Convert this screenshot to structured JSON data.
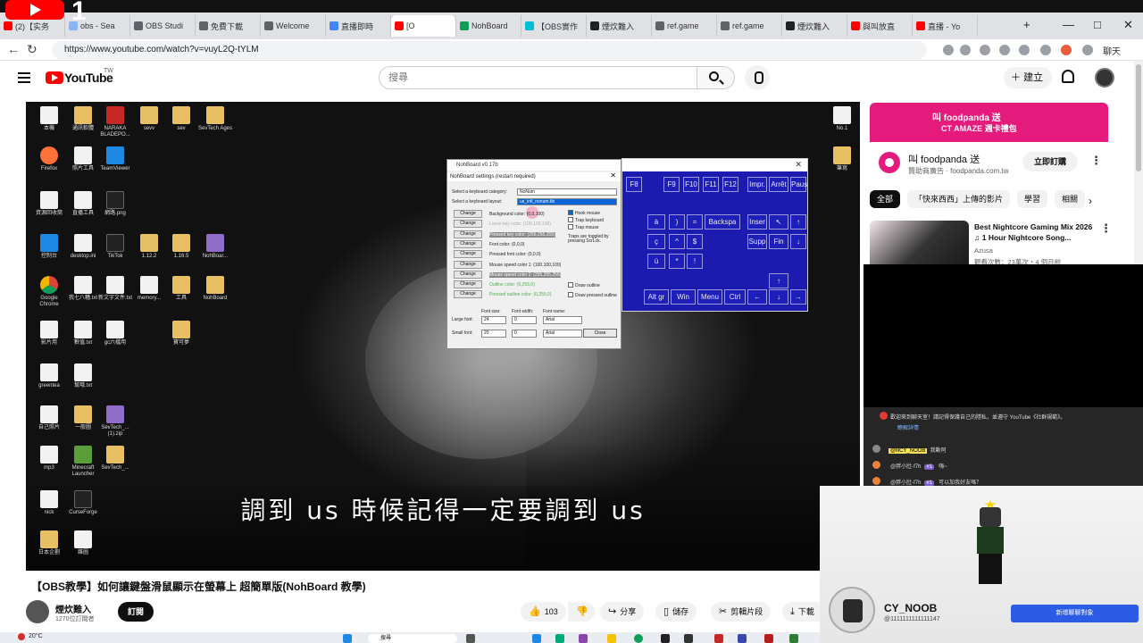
{
  "browser": {
    "tabs": [
      {
        "label": "(2)【实务",
        "color": "#ff0000"
      },
      {
        "label": "obs - Sea",
        "color": "#8ab4f8"
      },
      {
        "label": "OBS Studi",
        "color": "#5f6368"
      },
      {
        "label": "免費下載",
        "color": "#5f6368"
      },
      {
        "label": "Welcome",
        "color": "#5f6368"
      },
      {
        "label": "直播即時",
        "color": "#4285f4"
      },
      {
        "label": "[O",
        "color": "#ff0000"
      },
      {
        "label": "NohBoard",
        "color": "#0f9d58"
      },
      {
        "label": "【OBS實作",
        "color": "#00bcd4"
      },
      {
        "label": "煙炊難入",
        "color": "#202124"
      },
      {
        "label": "ref.game",
        "color": "#5f6368"
      },
      {
        "label": "ref.game",
        "color": "#5f6368"
      },
      {
        "label": "煙炊難入",
        "color": "#202124"
      },
      {
        "label": "與叫放直",
        "color": "#ff0000"
      },
      {
        "label": "直播 - Yo",
        "color": "#ff0000"
      }
    ],
    "big_count": "1",
    "url": "https://www.youtube.com/watch?v=vuyL2Q-tYLM",
    "chat_label": "聊天"
  },
  "youtube": {
    "logo_text": "YouTube",
    "region": "TW",
    "search_placeholder": "搜尋",
    "create_label": "建立"
  },
  "player": {
    "subtitle": "調到 us 時候記得一定要調到 us",
    "desktop_icons": [
      {
        "label": "本機",
        "type": "file"
      },
      {
        "label": "通訊軟體",
        "type": "folder"
      },
      {
        "label": "NARAKA BLADEPO...",
        "type": "red"
      },
      {
        "label": "sevv",
        "type": "folder"
      },
      {
        "label": "sev",
        "type": "folder"
      },
      {
        "label": "SevTech Ages",
        "type": "folder"
      },
      {
        "label": "Firefox",
        "type": "fox"
      },
      {
        "label": "照片工具",
        "type": "file"
      },
      {
        "label": "TeamViewer",
        "type": "blue"
      },
      {
        "label": "資源回收筒",
        "type": "file"
      },
      {
        "label": "直播工具",
        "type": "file"
      },
      {
        "label": "網路.png",
        "type": "dark"
      },
      {
        "label": "控制台",
        "type": "blue"
      },
      {
        "label": "desktop.ini",
        "type": "file"
      },
      {
        "label": "TikTok",
        "type": "dark"
      },
      {
        "label": "1.12.2",
        "type": "folder"
      },
      {
        "label": "1.16.5",
        "type": "folder"
      },
      {
        "label": "NohBoar...",
        "type": "win"
      },
      {
        "label": "Google Chrome",
        "type": "chrome"
      },
      {
        "label": "我七八糟.txt",
        "type": "file"
      },
      {
        "label": "新文字文件.txt",
        "type": "file"
      },
      {
        "label": "memory...",
        "type": "file"
      },
      {
        "label": "工具",
        "type": "folder"
      },
      {
        "label": "NohBoard",
        "type": "folder"
      },
      {
        "label": "影片用",
        "type": "file"
      },
      {
        "label": "數值.txt",
        "type": "file"
      },
      {
        "label": "gc六檔用",
        "type": "file"
      },
      {
        "label": "寶可夢",
        "type": "folder"
      },
      {
        "label": "greentea",
        "type": "file"
      },
      {
        "label": "幫哦.txt",
        "type": "file"
      },
      {
        "label": "自己照片",
        "type": "file"
      },
      {
        "label": "一般圖",
        "type": "folder"
      },
      {
        "label": "SevTech_...(1).zip",
        "type": "win"
      },
      {
        "label": "mp3",
        "type": "file"
      },
      {
        "label": "Minecraft Launcher",
        "type": "green"
      },
      {
        "label": "SevTech_...",
        "type": "folder"
      },
      {
        "label": "nick",
        "type": "file"
      },
      {
        "label": "CurseForge",
        "type": "dark"
      },
      {
        "label": "日本企劃",
        "type": "folder"
      },
      {
        "label": "雜圖",
        "type": "file"
      },
      {
        "label": "No.1",
        "type": "file"
      },
      {
        "label": "筆寫",
        "type": "folder"
      }
    ],
    "nohboard": {
      "keyboard_title": "NohBoard v0.17b",
      "keys": [
        "F8",
        "F9",
        "F10",
        "F11",
        "F12",
        "Impr.",
        "Arrêt",
        "Paus",
        "à",
        ")",
        "=",
        "Backspa",
        "Inser",
        "↖",
        "↑",
        "ç",
        "^",
        "$",
        "Supp",
        "Fin",
        "↓",
        "ù",
        "*",
        "!",
        "Alt gr",
        "Win",
        "Menu",
        "Ctrl",
        "↑",
        "←",
        "↓",
        "→"
      ],
      "settings_title": "NohBoard settings (restart required)",
      "select_category_label": "Select a keyboard category:",
      "select_category_value": "NoNum",
      "select_layout_label": "Select a keyboard layout:",
      "select_layout_value": "us_intl_nonum.kb",
      "change_label": "Change",
      "color_rows": [
        "Background color: (0,0,100)",
        "Loose key color: (100,100,100)",
        "Pressed key color: (255,255,255)",
        "Font color: (0,0,0)",
        "Pressed font color: (0,0,0)",
        "Mouse speed color 1: (100,100,100)",
        "Mouse speed color 2: (255,255,255)",
        "Outline color: (0,255,0)",
        "Pressed outline color: (0,255,0)"
      ],
      "checks": [
        "Hook mouse",
        "Trap keyboard",
        "Trap mouse"
      ],
      "trap_note": "Traps are toggled by pressing ScrLck.",
      "outline_checks": [
        "Draw outline",
        "Draw pressed outline"
      ],
      "font_headers": [
        "Font size:",
        "Font width:",
        "Font name:"
      ],
      "large_font": {
        "label": "Large font:",
        "size": "24",
        "width": "0",
        "name": "Arial"
      },
      "small_font": {
        "label": "Small font:",
        "size": "20",
        "width": "0",
        "name": "Arial"
      },
      "close_label": "Close"
    }
  },
  "video": {
    "title": "【OBS教學】如何讓鍵盤滑鼠顯示在螢幕上 超簡單版(NohBoard 教學)",
    "channel": "煙炊難入",
    "subscribers": "1270位訂閱者",
    "subscribe_label": "訂閱",
    "likes": "103",
    "actions": [
      "分享",
      "儲存",
      "剪輯片段",
      "下載"
    ]
  },
  "sidebar": {
    "ad_banner_line1": "叫 foodpanda 送",
    "ad_banner_line2": "CT AMAZE 週卡禮包",
    "ad_title": "叫 foodpanda 送",
    "ad_sponsor": "贊助商廣告 · foodpanda.com.tw",
    "ad_cta": "立即訂購",
    "chips": [
      "全部",
      "「快來西西」上傳的影片",
      "學習",
      "相關"
    ],
    "recommendation": {
      "title": "Best Nightcore Gaming Mix 2026 ♫ 1 Hour Nightcore Song...",
      "channel": "Azusa",
      "meta": "觀看次數：23萬次・4 個月前"
    }
  },
  "chat": {
    "notice": "歡迎來到聊天室！請記得保護自己的隱私，並遵守 YouTube《社群規範》。",
    "notice_link": "瞭解詳情",
    "messages": [
      {
        "name": "@lllCY_NOOB",
        "badge": "",
        "text": "我動阿",
        "owner": true
      },
      {
        "name": "@胖小壯-f7h",
        "badge": "#1",
        "text": "嗨~",
        "owner": false
      },
      {
        "name": "@胖小壯-f7h",
        "badge": "#1",
        "text": "可以加我好友嗎？",
        "owner": false
      }
    ]
  },
  "streamer": {
    "name": "CY_NOOB",
    "handle": "@1111111111111147",
    "button": "新增聊聊對象"
  },
  "taskbar": {
    "temperature": "20°C",
    "search": "搜尋"
  }
}
